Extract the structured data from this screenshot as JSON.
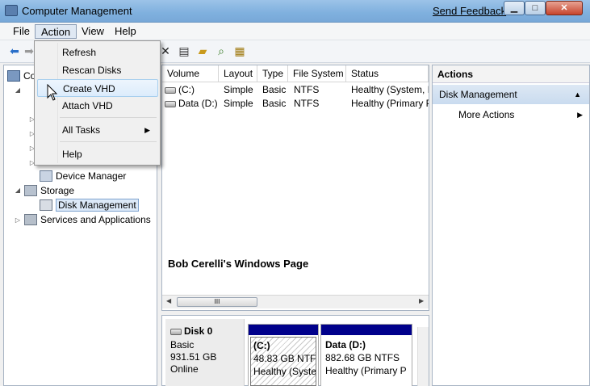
{
  "window": {
    "title": "Computer Management",
    "feedback_link": "Send Feedback",
    "minimize_glyph": "▁",
    "maximize_glyph": "□",
    "close_glyph": "✕"
  },
  "menubar": {
    "items": [
      {
        "label": "File"
      },
      {
        "label": "Action"
      },
      {
        "label": "View"
      },
      {
        "label": "Help"
      }
    ],
    "active": "Action"
  },
  "action_menu": {
    "items": [
      {
        "label": "Refresh"
      },
      {
        "label": "Rescan Disks"
      },
      {
        "label": "Create VHD"
      },
      {
        "label": "Attach VHD"
      },
      {
        "label": "All Tasks"
      },
      {
        "label": "Help"
      }
    ],
    "highlighted": "Create VHD",
    "submenu_arrow": "▶"
  },
  "toolbar": {
    "icons": [
      "back-icon",
      "forward-icon",
      "delete-icon",
      "properties-icon",
      "open-folder-icon",
      "magnify-icon",
      "disk-tool-icon"
    ]
  },
  "tree": {
    "root_fragment": "Co",
    "items": [
      {
        "label": "Device Manager"
      },
      {
        "label": "Storage"
      },
      {
        "label": "Disk Management"
      },
      {
        "label": "Services and Applications"
      }
    ],
    "selected": "Disk Management"
  },
  "volumes": {
    "columns": [
      "Volume",
      "Layout",
      "Type",
      "File System",
      "Status"
    ],
    "rows": [
      {
        "volume": "(C:)",
        "layout": "Simple",
        "type": "Basic",
        "fs": "NTFS",
        "status": "Healthy (System, B"
      },
      {
        "volume": "Data (D:)",
        "layout": "Simple",
        "type": "Basic",
        "fs": "NTFS",
        "status": "Healthy (Primary P"
      }
    ]
  },
  "watermark": "Bob Cerelli's Windows Page",
  "scroll_thumb_glyph": "III",
  "disk0": {
    "name": "Disk 0",
    "type": "Basic",
    "size": "931.51 GB",
    "state": "Online",
    "partitions": [
      {
        "name": "(C:)",
        "size": "48.83 GB NTFS",
        "status": "Healthy (Syste"
      },
      {
        "name": "Data  (D:)",
        "size": "882.68 GB NTFS",
        "status": "Healthy (Primary P"
      }
    ],
    "colors": {
      "bar": "#00008b"
    }
  },
  "actions_pane": {
    "title": "Actions",
    "section": "Disk Management",
    "item": "More Actions"
  }
}
